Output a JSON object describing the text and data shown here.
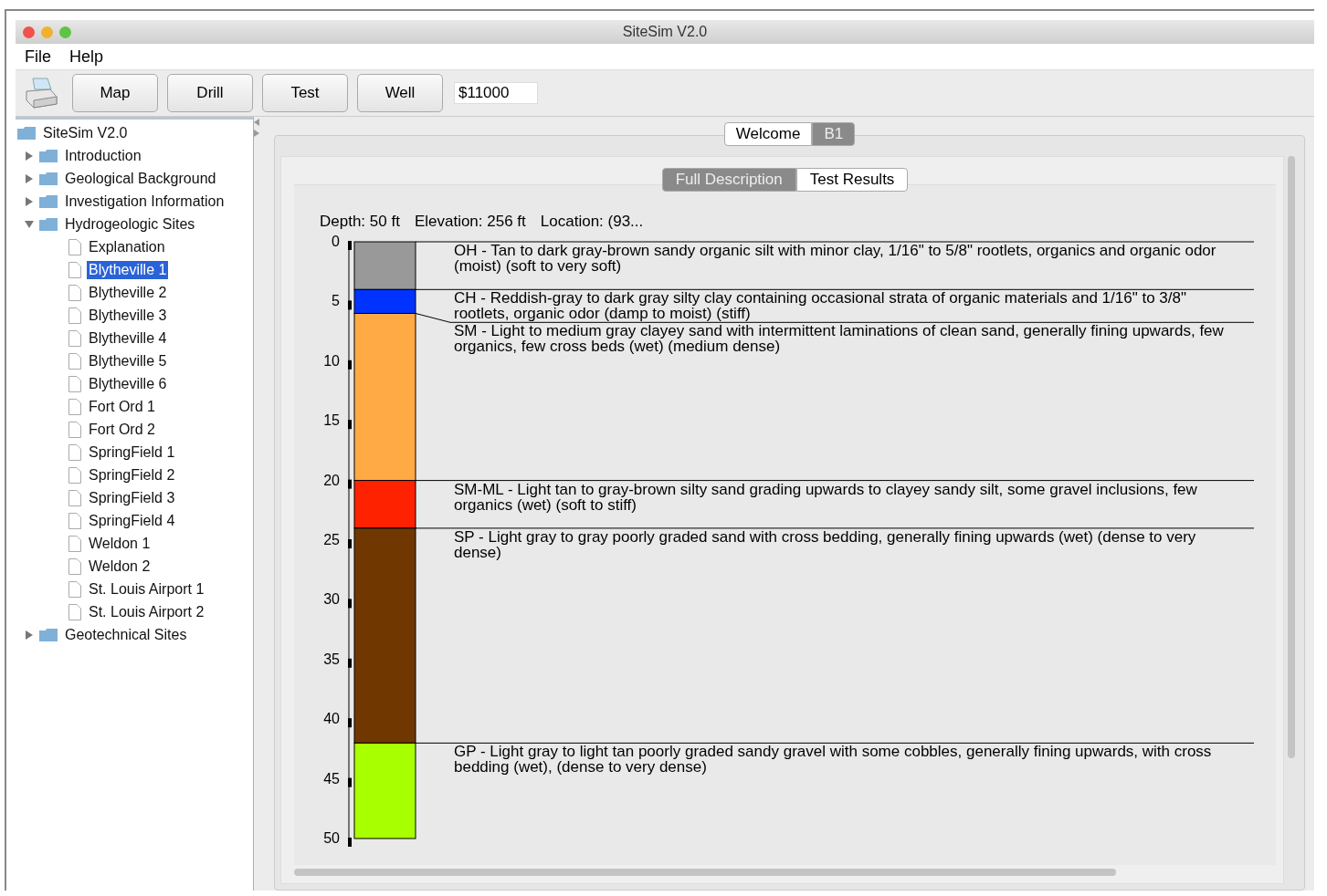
{
  "window": {
    "title": "SiteSim V2.0"
  },
  "menu": [
    "File",
    "Help"
  ],
  "toolbar": {
    "buttons": [
      "Map",
      "Drill",
      "Test",
      "Well"
    ],
    "budget": "$11000"
  },
  "tree": {
    "label": "SiteSim V2.0",
    "children": [
      {
        "label": "Introduction",
        "expanded": false,
        "selected": false
      },
      {
        "label": "Geological Background",
        "expanded": false,
        "selected": false
      },
      {
        "label": "Investigation Information",
        "expanded": false,
        "selected": false
      },
      {
        "label": "Hydrogeologic Sites",
        "expanded": true,
        "selected": false,
        "children": [
          {
            "label": "Explanation",
            "selected": false
          },
          {
            "label": "Blytheville 1",
            "selected": true
          },
          {
            "label": "Blytheville 2",
            "selected": false
          },
          {
            "label": "Blytheville 3",
            "selected": false
          },
          {
            "label": "Blytheville 4",
            "selected": false
          },
          {
            "label": "Blytheville 5",
            "selected": false
          },
          {
            "label": "Blytheville 6",
            "selected": false
          },
          {
            "label": "Fort Ord 1",
            "selected": false
          },
          {
            "label": "Fort Ord 2",
            "selected": false
          },
          {
            "label": "SpringField 1",
            "selected": false
          },
          {
            "label": "SpringField 2",
            "selected": false
          },
          {
            "label": "SpringField 3",
            "selected": false
          },
          {
            "label": "SpringField 4",
            "selected": false
          },
          {
            "label": "Weldon 1",
            "selected": false
          },
          {
            "label": "Weldon 2",
            "selected": false
          },
          {
            "label": "St. Louis Airport 1",
            "selected": false
          },
          {
            "label": "St. Louis Airport 2",
            "selected": false
          }
        ]
      },
      {
        "label": "Geotechnical Sites",
        "expanded": false,
        "selected": false
      }
    ]
  },
  "tabs": [
    {
      "label": "Welcome",
      "selected": false
    },
    {
      "label": "B1",
      "selected": true
    }
  ],
  "subtabs": [
    {
      "label": "Full Description",
      "selected": true
    },
    {
      "label": "Test Results",
      "selected": false
    }
  ],
  "log": {
    "header": [
      "Depth: 50 ft",
      "Elevation: 256 ft",
      "Location: (93..."
    ],
    "chart_data": {
      "type": "bar",
      "stacked": true,
      "orientation": "vertical",
      "ylim": [
        50,
        0
      ],
      "legend": "right",
      "yticks": [
        0,
        5,
        10,
        15,
        20,
        25,
        30,
        35,
        40,
        45,
        50
      ],
      "series": [
        {
          "name": "OH",
          "color": "#999999",
          "values": [
            4
          ]
        },
        {
          "name": "CH",
          "color": "#0033ff",
          "values": [
            2
          ]
        },
        {
          "name": "SM",
          "color": "#ffaa44",
          "values": [
            14
          ]
        },
        {
          "name": "SM-ML",
          "color": "#ff2200",
          "values": [
            4
          ]
        },
        {
          "name": "SP",
          "color": "#703800",
          "values": [
            18
          ]
        },
        {
          "name": "GP",
          "color": "#a8ff00",
          "values": [
            8
          ]
        }
      ]
    },
    "descriptions": [
      "- Tan to dark gray-brown sandy organic silt with minor clay, 1/16\" to 5/8\" rootlets, organics and organic odor (moist) (soft to very soft)",
      "- Reddish-gray to dark gray silty clay containing occasional strata of organic materials and 1/16\" to 3/8\" rootlets, organic odor (damp to moist) (stiff)",
      "- Light to medium gray clayey sand with intermittent laminations of clean sand, generally fining upwards, few organics, few cross beds (wet) (medium dense)",
      "- Light tan to gray-brown silty sand grading upwards to clayey sandy silt, some gravel inclusions, few organics (wet) (soft to stiff)",
      "- Light gray to gray poorly graded sand with cross bedding, generally fining upwards (wet) (dense to very dense)",
      "- Light gray to light tan poorly graded sandy gravel with some cobbles, generally fining upwards, with cross bedding (wet), (dense to very dense)"
    ]
  }
}
